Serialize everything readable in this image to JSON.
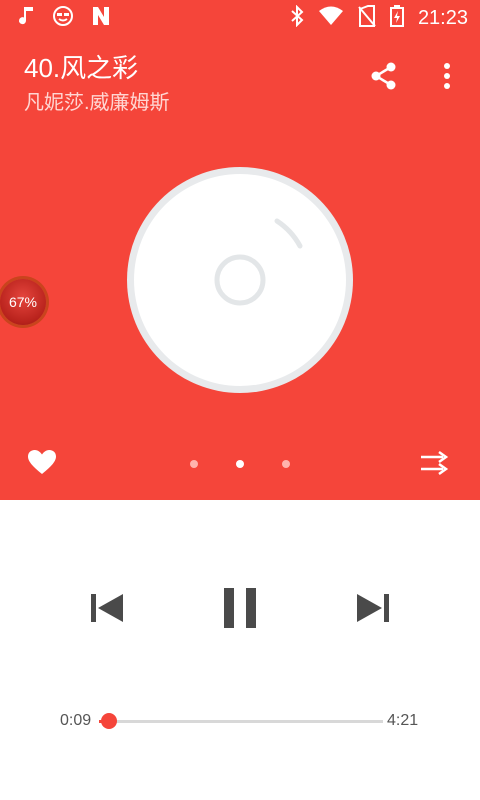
{
  "status_bar": {
    "time": "21:23",
    "left_icons": [
      "music-note-icon",
      "smiley-glasses-icon",
      "n-logo-icon"
    ],
    "right_icons": [
      "bluetooth-icon",
      "wifi-icon",
      "no-sim-icon",
      "battery-charging-icon"
    ]
  },
  "song": {
    "title": "40.风之彩",
    "artist": "凡妮莎.威廉姆斯"
  },
  "header_actions": [
    "share-icon",
    "more-vert-icon"
  ],
  "overlay_badge": {
    "text": "67%"
  },
  "pager": {
    "count": 3,
    "active_index": 1
  },
  "player": {
    "elapsed": "0:09",
    "total": "4:21",
    "progress_fraction": 0.034
  },
  "colors": {
    "accent": "#f5453a",
    "background": "#ffffff"
  }
}
